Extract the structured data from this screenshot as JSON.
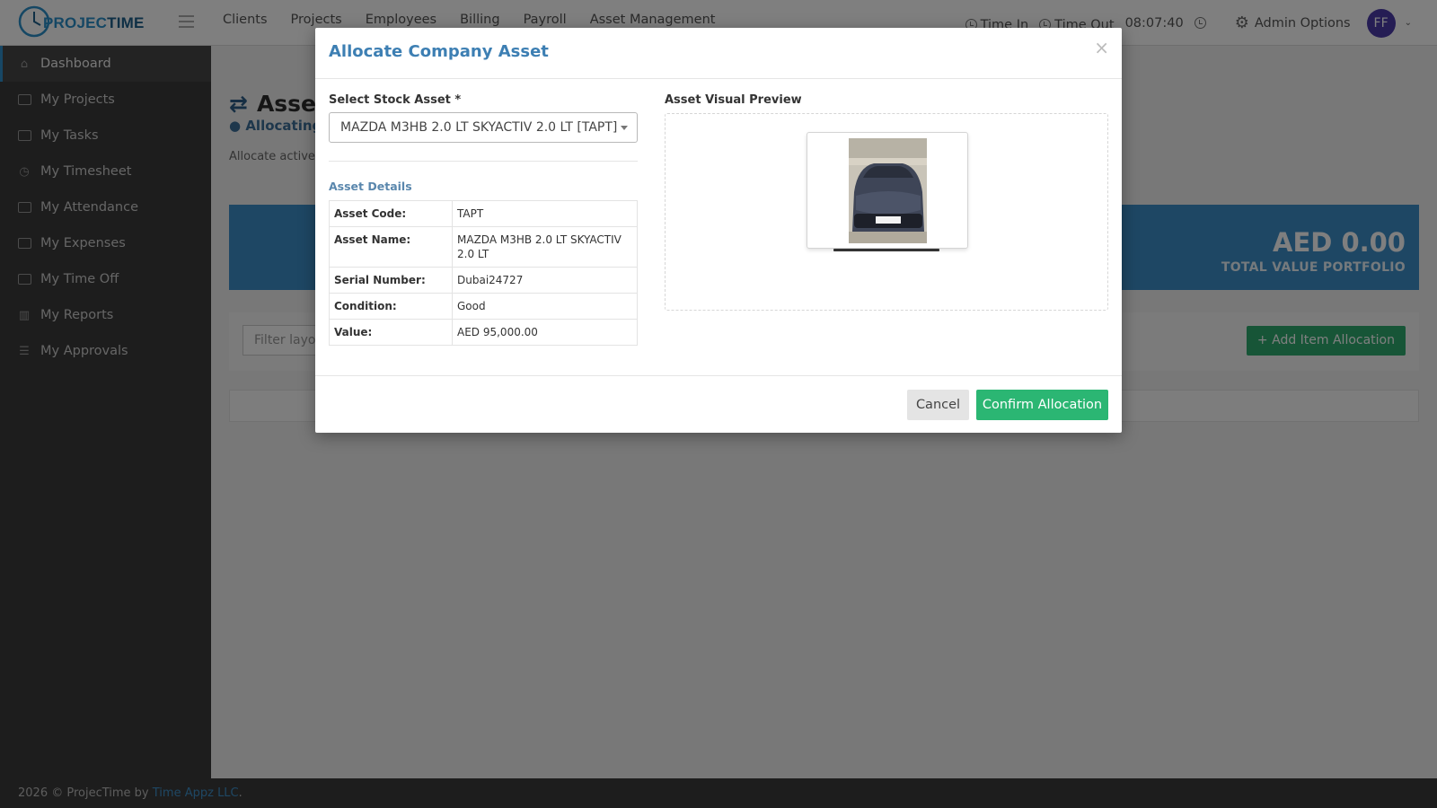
{
  "brand": {
    "name_part1": "PROJEC",
    "name_part2": "TIME"
  },
  "topnav": {
    "items": [
      "Clients",
      "Projects",
      "Employees",
      "Billing",
      "Payroll",
      "Asset Management"
    ]
  },
  "topright": {
    "time_in": "Time In",
    "time_out": "Time Out",
    "clock": "08:07:40",
    "admin": "Admin Options",
    "avatar": "FF"
  },
  "sidebar": {
    "items": [
      {
        "label": "Dashboard",
        "icon": "home-icon"
      },
      {
        "label": "My Projects",
        "icon": "folder-icon"
      },
      {
        "label": "My Tasks",
        "icon": "tasks-icon"
      },
      {
        "label": "My Timesheet",
        "icon": "clock-icon"
      },
      {
        "label": "My Attendance",
        "icon": "calendar-check-icon"
      },
      {
        "label": "My Expenses",
        "icon": "money-icon"
      },
      {
        "label": "My Time Off",
        "icon": "calendar-icon"
      },
      {
        "label": "My Reports",
        "icon": "bar-chart-icon"
      },
      {
        "label": "My Approvals",
        "icon": "list-icon"
      }
    ]
  },
  "page": {
    "title": "Asset",
    "subtitle": "Allocating",
    "desc": "Allocate active s",
    "total_value": "AED 0.00",
    "total_label": "TOTAL VALUE PORTFOLIO",
    "filter_placeholder": "Filter layou",
    "add_button": "Add Item Allocation"
  },
  "modal": {
    "title": "Allocate Company Asset",
    "close": "×",
    "select_label": "Select Stock Asset *",
    "selected_asset": "MAZDA M3HB 2.0 LT SKYACTIV 2.0 LT [TAPT]",
    "details_title": "Asset Details",
    "details": [
      {
        "key": "Asset Code:",
        "value": "TAPT"
      },
      {
        "key": "Asset Name:",
        "value": "MAZDA M3HB 2.0 LT SKYACTIV 2.0 LT"
      },
      {
        "key": "Serial Number:",
        "value": "Dubai24727"
      },
      {
        "key": "Condition:",
        "value": "Good"
      },
      {
        "key": "Value:",
        "value": "AED 95,000.00"
      }
    ],
    "preview_label": "Asset Visual Preview",
    "cancel": "Cancel",
    "confirm": "Confirm Allocation"
  },
  "footer": {
    "text": "2026 © ProjecTime by ",
    "link": "Time Appz LLC",
    "end": "."
  },
  "colors": {
    "accent": "#3d8fc9",
    "success": "#2bb673",
    "sidebar": "#3b3b3b"
  }
}
